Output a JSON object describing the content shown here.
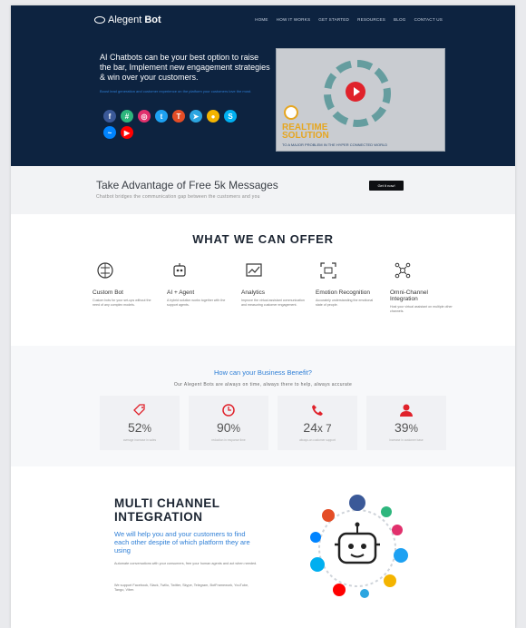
{
  "header": {
    "logo_text": "Alegent",
    "logo_bold": "Bot",
    "nav": [
      "HOME",
      "HOW IT WORKS",
      "GET STARTED",
      "RESOURCES",
      "BLOG",
      "CONTACT US"
    ]
  },
  "hero": {
    "headline": "AI Chatbots can be your best option to raise the bar, Implement new engagement strategies & win over your customers.",
    "subtext": "Boost lead generation and customer experience on the platform your customers love the most.",
    "social_icons": [
      {
        "name": "facebook-icon",
        "glyph": "f",
        "color": "#3b5998"
      },
      {
        "name": "slack-icon",
        "glyph": "#",
        "color": "#2eb67d"
      },
      {
        "name": "instagram-icon",
        "glyph": "◎",
        "color": "#e1306c"
      },
      {
        "name": "twitter-icon",
        "glyph": "t",
        "color": "#1da1f2"
      },
      {
        "name": "teams-icon",
        "glyph": "T",
        "color": "#e44d26"
      },
      {
        "name": "telegram-icon",
        "glyph": "➤",
        "color": "#2ca5e0"
      },
      {
        "name": "google-assistant-icon",
        "glyph": "●",
        "color": "#f4b400"
      },
      {
        "name": "skype-icon",
        "glyph": "S",
        "color": "#00aff0"
      },
      {
        "name": "messenger-icon",
        "glyph": "~",
        "color": "#0084ff"
      },
      {
        "name": "youtube-icon",
        "glyph": "▶",
        "color": "#ff0000"
      }
    ],
    "video": {
      "title_line1": "REALTIME",
      "title_line2": "SOLUTION",
      "caption": "TO A MAJOR PROBLEM IN THE HYPER CONNECTED WORLD"
    }
  },
  "free": {
    "title": "Take Advantage of Free 5k Messages",
    "subtitle": "Chatbot bridges the communication gap between the customers and you",
    "button": "Get it now!"
  },
  "offer": {
    "title": "WHAT WE CAN OFFER",
    "items": [
      {
        "title": "Custom Bot",
        "desc": "Custom bots for your set-ups without the need of any complex models."
      },
      {
        "title": "AI + Agent",
        "desc": "A hybrid solution works together with the support agents."
      },
      {
        "title": "Analytics",
        "desc": "Improve the virtual assistant communication and measuring customer engagement."
      },
      {
        "title": "Emotion Recognition",
        "desc": "Accurately understanding the emotional state of people."
      },
      {
        "title": "Omni-Channel Integration",
        "desc": "Host your virtual assistant on multiple other channels."
      }
    ]
  },
  "benefit": {
    "title": "How can your Business Benefit?",
    "subtitle": "Our Alegent Bots are always on time, always there to help, always accurate",
    "stats": [
      {
        "value": "52",
        "unit": "%",
        "label": "average increase in sales"
      },
      {
        "value": "90",
        "unit": "%",
        "label": "reduction in response time"
      },
      {
        "value": "24",
        "unit": "x 7",
        "label": "always-on customer support"
      },
      {
        "value": "39",
        "unit": "%",
        "label": "increase in customer base"
      }
    ]
  },
  "multichannel": {
    "title_line1": "MULTI CHANNEL",
    "title_line2": "INTEGRATION",
    "subtitle": "We will help you and your customers to find each other despite of which platform they are using",
    "para1": "Automate conversations with your consumers, free your human agents and act when needed.",
    "para2": "We support Facebook, Slack, Twilio, Twitter, Skype, Telegram, BotFramework, YouTube, Tango, Viber."
  }
}
